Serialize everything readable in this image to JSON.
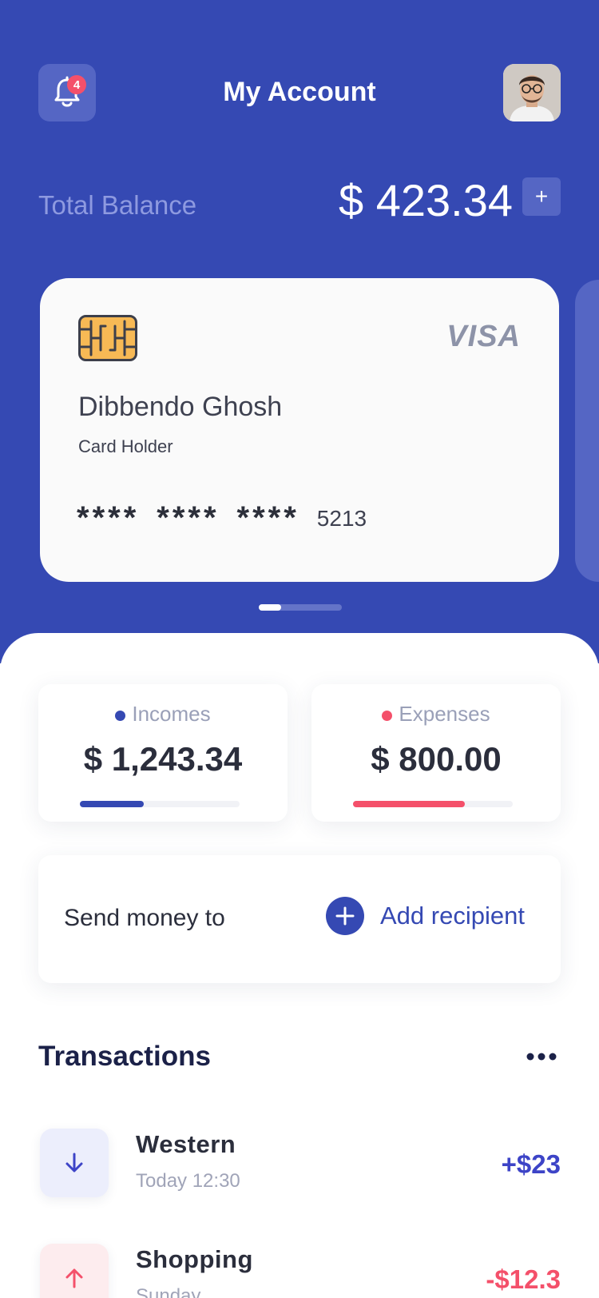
{
  "header": {
    "title": "My Account",
    "notification_count": "4"
  },
  "balance": {
    "label": "Total Balance",
    "value": "$ 423.34",
    "add_label": "+"
  },
  "card": {
    "brand": "VISA",
    "holder_name": "Dibbendo Ghosh",
    "holder_label": "Card Holder",
    "masked_groups": [
      "****",
      "****",
      "****"
    ],
    "last4": "5213",
    "carousel_index": 1,
    "carousel_count": 4
  },
  "stats": {
    "incomes": {
      "label": "Incomes",
      "value": "$ 1,243.34",
      "progress": 0.4,
      "color": "#3549b3"
    },
    "expenses": {
      "label": "Expenses",
      "value": "$ 800.00",
      "progress": 0.7,
      "color": "#f4506a"
    }
  },
  "send": {
    "label": "Send money to",
    "add_recipient_label": "Add recipient"
  },
  "transactions": {
    "title": "Transactions",
    "items": [
      {
        "name": "Western",
        "time": "Today 12:30",
        "amount": "+$23",
        "direction": "in",
        "amount_color": "#3d44c7",
        "icon_bg": "#eceefc",
        "icon": "arrow-down-icon"
      },
      {
        "name": "Shopping",
        "time": "Sunday",
        "amount": "-$12.3",
        "direction": "out",
        "amount_color": "#f4506a",
        "icon_bg": "#fdecee",
        "icon": "arrow-up-icon"
      }
    ]
  },
  "colors": {
    "primary": "#3549b3",
    "expense": "#f4506a"
  }
}
